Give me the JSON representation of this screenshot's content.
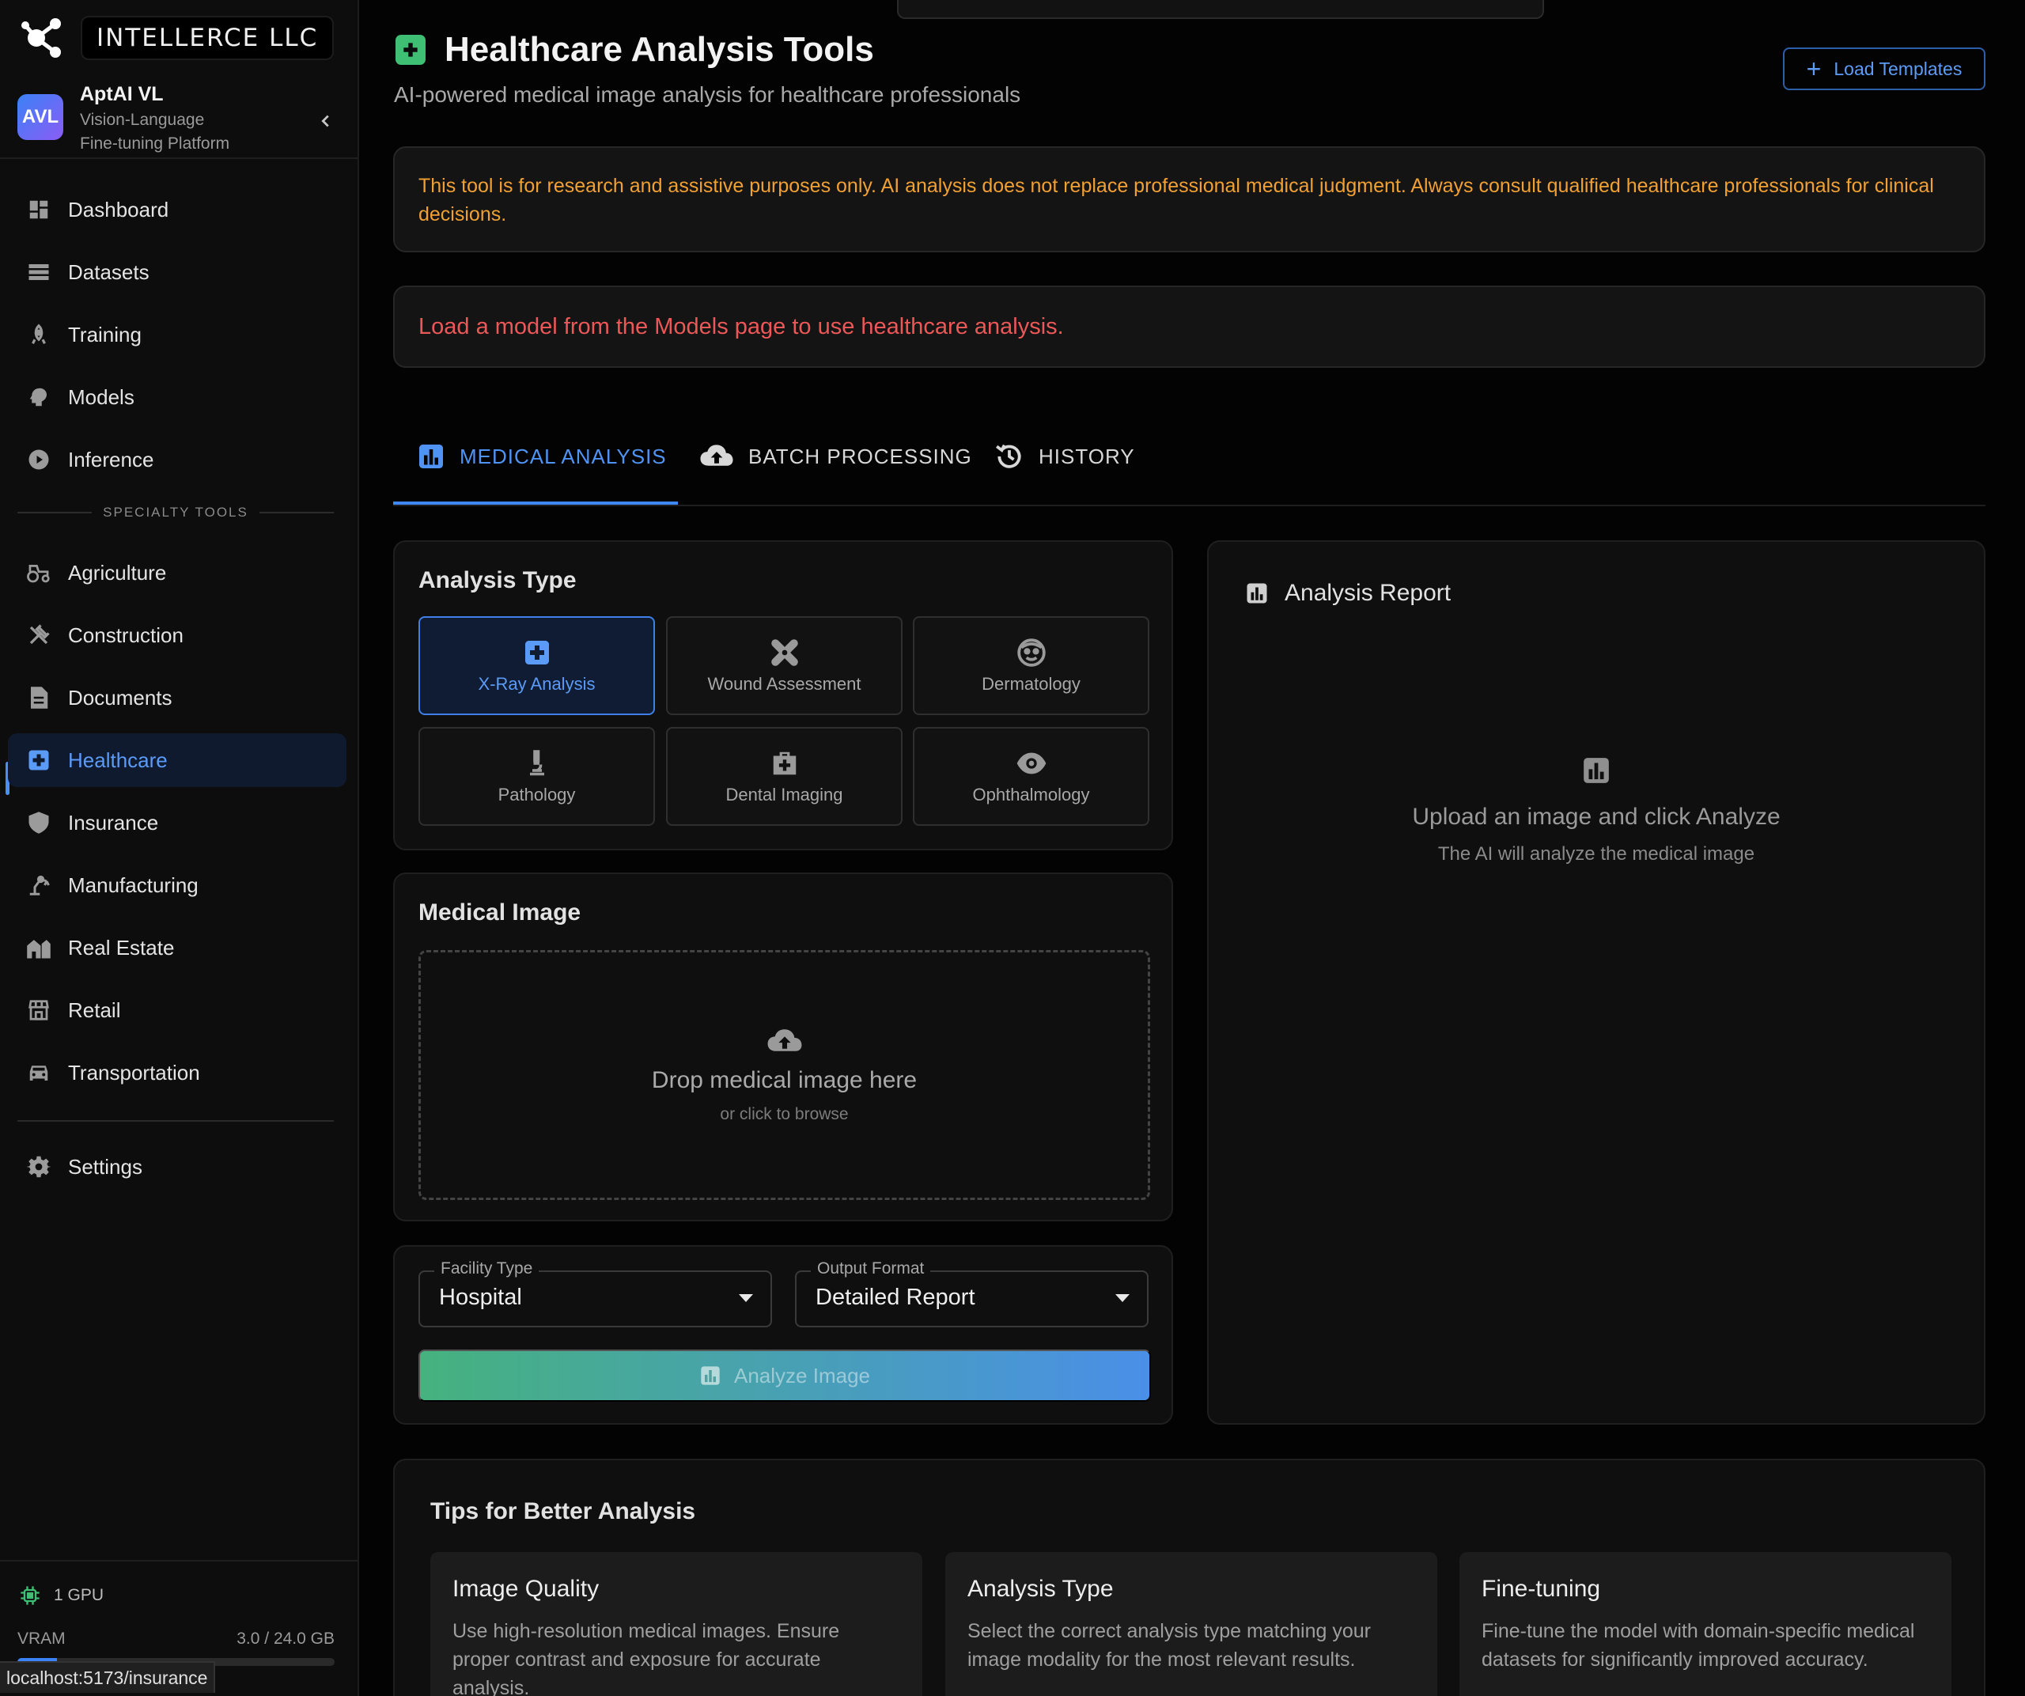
{
  "brand": {
    "name": "INTELLERCE LLC"
  },
  "user": {
    "initials": "AVL",
    "name": "AptAI VL",
    "subtitle_line1": "Vision-Language",
    "subtitle_line2": "Fine-tuning Platform"
  },
  "nav": {
    "main": [
      {
        "label": "Dashboard",
        "icon": "dashboard-icon"
      },
      {
        "label": "Datasets",
        "icon": "datasets-icon"
      },
      {
        "label": "Training",
        "icon": "training-icon"
      },
      {
        "label": "Models",
        "icon": "models-icon"
      },
      {
        "label": "Inference",
        "icon": "play-circle-icon"
      }
    ],
    "section_label": "SPECIALTY TOOLS",
    "specialty": [
      {
        "label": "Agriculture",
        "icon": "tractor-icon"
      },
      {
        "label": "Construction",
        "icon": "tools-icon"
      },
      {
        "label": "Documents",
        "icon": "document-icon"
      },
      {
        "label": "Healthcare",
        "icon": "medical-cross-icon",
        "active": true
      },
      {
        "label": "Insurance",
        "icon": "shield-icon"
      },
      {
        "label": "Manufacturing",
        "icon": "robot-arm-icon"
      },
      {
        "label": "Real Estate",
        "icon": "building-icon"
      },
      {
        "label": "Retail",
        "icon": "storefront-icon"
      },
      {
        "label": "Transportation",
        "icon": "car-icon"
      }
    ],
    "settings": {
      "label": "Settings",
      "icon": "gear-icon"
    }
  },
  "system": {
    "gpu_label": "1 GPU",
    "vram_label": "VRAM",
    "vram_value": "3.0 / 24.0 GB",
    "vram_fraction": 0.125
  },
  "status_url": "localhost:5173/insurance",
  "page": {
    "title": "Healthcare Analysis Tools",
    "subtitle": "AI-powered medical image analysis for healthcare professionals",
    "load_templates": "Load Templates",
    "warning": "This tool is for research and assistive purposes only. AI analysis does not replace professional medical judgment. Always consult qualified healthcare professionals for clinical decisions.",
    "error": "Load a model from the Models page to use healthcare analysis."
  },
  "tabs": [
    {
      "label": "MEDICAL ANALYSIS",
      "icon": "chart-icon",
      "active": true
    },
    {
      "label": "BATCH PROCESSING",
      "icon": "cloud-upload-icon"
    },
    {
      "label": "HISTORY",
      "icon": "history-icon"
    }
  ],
  "analysis_type": {
    "title": "Analysis Type",
    "options": [
      {
        "label": "X-Ray Analysis",
        "icon": "medical-cross-icon",
        "active": true
      },
      {
        "label": "Wound Assessment",
        "icon": "bandage-icon"
      },
      {
        "label": "Dermatology",
        "icon": "face-icon"
      },
      {
        "label": "Pathology",
        "icon": "microscope-icon"
      },
      {
        "label": "Dental Imaging",
        "icon": "medical-bag-icon"
      },
      {
        "label": "Ophthalmology",
        "icon": "eye-icon"
      }
    ]
  },
  "medical_image": {
    "title": "Medical Image",
    "drop_text": "Drop medical image here",
    "browse_text": "or click to browse"
  },
  "controls": {
    "facility_label": "Facility Type",
    "facility_value": "Hospital",
    "output_label": "Output Format",
    "output_value": "Detailed Report",
    "analyze_button": "Analyze Image"
  },
  "report": {
    "title": "Analysis Report",
    "empty_main": "Upload an image and click Analyze",
    "empty_sub": "The AI will analyze the medical image"
  },
  "tips": {
    "title": "Tips for Better Analysis",
    "cards": [
      {
        "title": "Image Quality",
        "body": "Use high-resolution medical images. Ensure proper contrast and exposure for accurate analysis."
      },
      {
        "title": "Analysis Type",
        "body": "Select the correct analysis type matching your image modality for the most relevant results."
      },
      {
        "title": "Fine-tuning",
        "body": "Fine-tune the model with domain-specific medical datasets for significantly improved accuracy."
      }
    ]
  },
  "colors": {
    "accent": "#4f93f5",
    "warning": "#f1a033",
    "error": "#ec5757",
    "healthcare_green": "#3fbf74"
  }
}
